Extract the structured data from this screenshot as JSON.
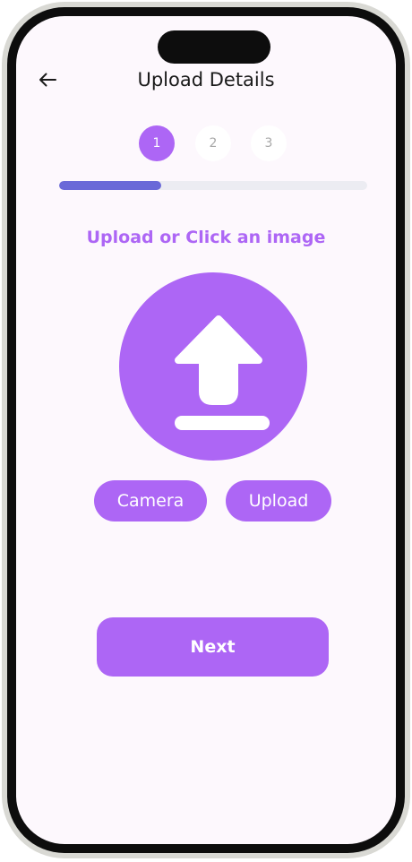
{
  "header": {
    "back_icon": "arrow-left-icon",
    "title": "Upload Details"
  },
  "steps": [
    {
      "label": "1",
      "state": "active"
    },
    {
      "label": "2",
      "state": "inactive"
    },
    {
      "label": "3",
      "state": "inactive"
    }
  ],
  "progress": {
    "fraction": 0.33,
    "fill_color": "#6a69d8",
    "track_color": "#ececf2"
  },
  "upload": {
    "prompt": "Upload or Click an image",
    "icon": "upload-arrow-icon",
    "camera_label": "Camera",
    "upload_label": "Upload"
  },
  "footer": {
    "next_label": "Next"
  },
  "colors": {
    "accent": "#ad66f5",
    "background": "#fdf8fd"
  }
}
